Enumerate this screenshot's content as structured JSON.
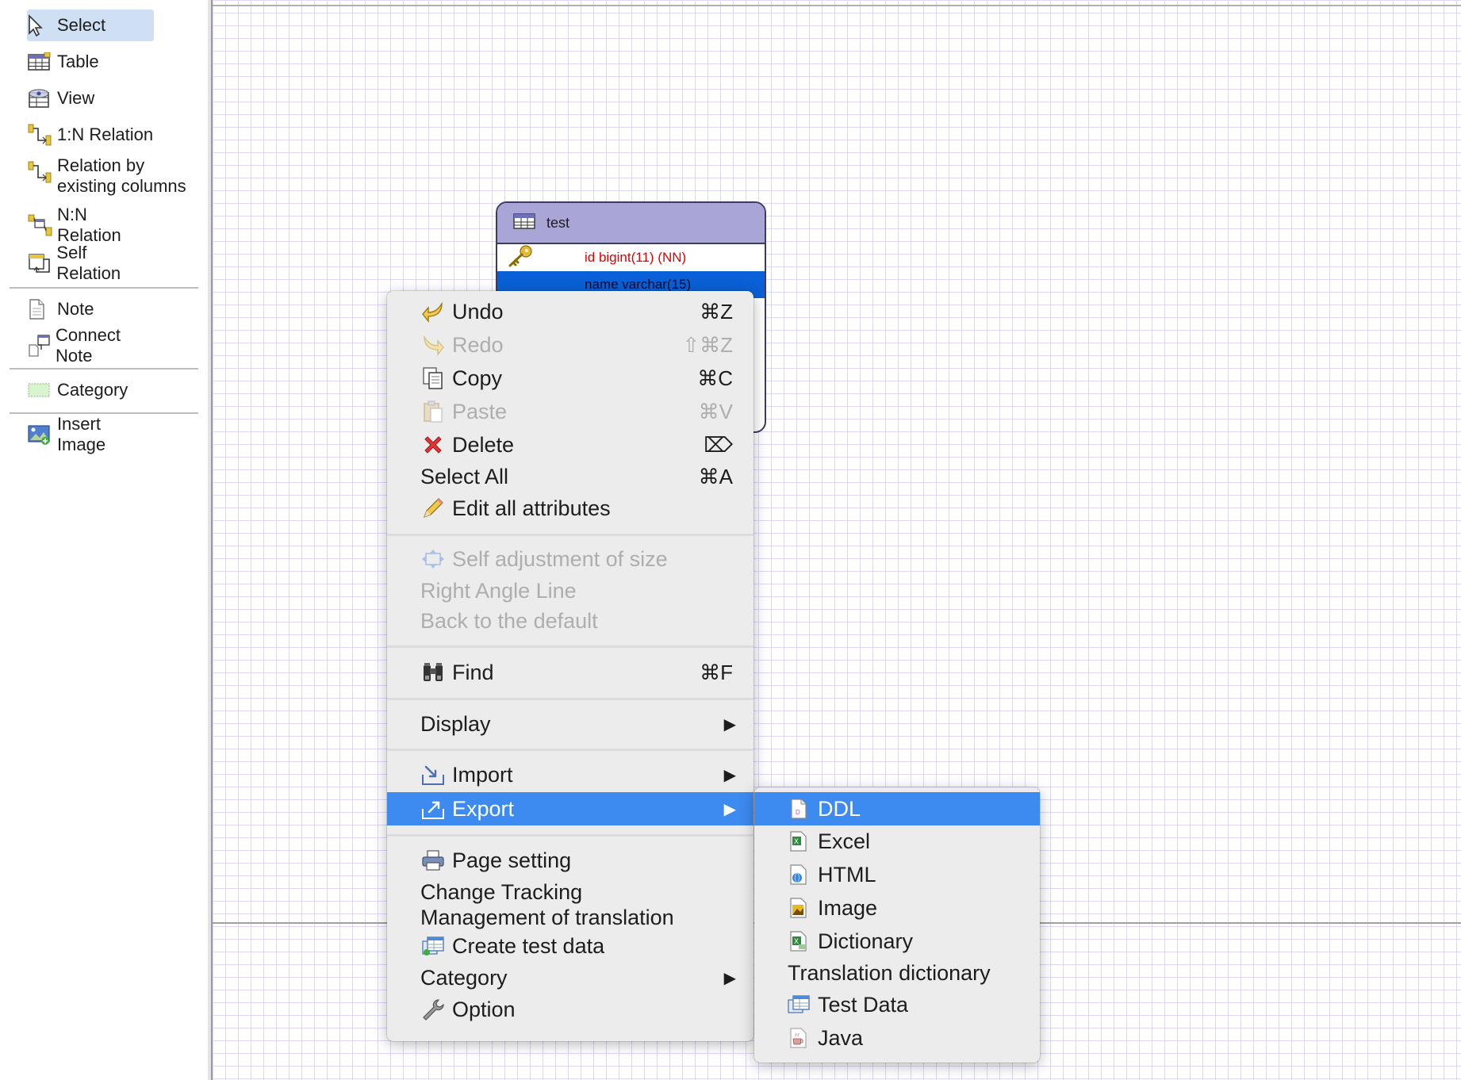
{
  "palette": {
    "items": [
      {
        "label": "Select",
        "icon": "cursor-icon"
      },
      {
        "label": "Table",
        "icon": "table-icon"
      },
      {
        "label": "View",
        "icon": "view-icon"
      },
      {
        "label": "1:N Relation",
        "icon": "relation-1n-icon"
      },
      {
        "label_line1": "Relation by",
        "label_line2": "existing columns",
        "icon": "relation-existing-icon"
      },
      {
        "label": "N:N Relation",
        "icon": "relation-nn-icon"
      },
      {
        "label": "Self Relation",
        "icon": "self-relation-icon"
      },
      {
        "label": "Note",
        "icon": "note-icon"
      },
      {
        "label": "Connect Note",
        "icon": "connect-note-icon"
      },
      {
        "label": "Category",
        "icon": "category-icon"
      },
      {
        "label": "Insert Image",
        "icon": "insert-image-icon"
      }
    ]
  },
  "entity": {
    "name": "test",
    "columns": [
      {
        "text": "id bigint(11) (NN)",
        "primary_key": true
      },
      {
        "text": "name varchar(15)",
        "primary_key": false
      }
    ]
  },
  "context_menu": {
    "undo": {
      "label": "Undo",
      "shortcut": "⌘Z"
    },
    "redo": {
      "label": "Redo",
      "shortcut": "⇧⌘Z"
    },
    "copy": {
      "label": "Copy",
      "shortcut": "⌘C"
    },
    "paste": {
      "label": "Paste",
      "shortcut": "⌘V"
    },
    "delete": {
      "label": "Delete",
      "shortcut": "⌦"
    },
    "select_all": {
      "label": "Select All",
      "shortcut": "⌘A"
    },
    "edit_all": {
      "label": "Edit all attributes"
    },
    "self_adjust": {
      "label": "Self adjustment of size"
    },
    "right_angle": {
      "label": "Right Angle Line"
    },
    "back_default": {
      "label": "Back to the default"
    },
    "find": {
      "label": "Find",
      "shortcut": "⌘F"
    },
    "display": {
      "label": "Display",
      "arrow": "▶"
    },
    "import": {
      "label": "Import",
      "arrow": "▶"
    },
    "export": {
      "label": "Export",
      "arrow": "▶"
    },
    "page_setting": {
      "label": "Page setting"
    },
    "change_tracking": {
      "label": "Change Tracking"
    },
    "translation": {
      "label": "Management of translation"
    },
    "test_data": {
      "label": "Create test data"
    },
    "category": {
      "label": "Category",
      "arrow": "▶"
    },
    "option": {
      "label": "Option"
    }
  },
  "export_submenu": {
    "ddl": {
      "label": "DDL"
    },
    "excel": {
      "label": "Excel"
    },
    "html": {
      "label": "HTML"
    },
    "image": {
      "label": "Image"
    },
    "dictionary": {
      "label": "Dictionary"
    },
    "translation_dictionary": {
      "label": "Translation dictionary"
    },
    "test_data": {
      "label": "Test Data"
    },
    "java": {
      "label": "Java"
    }
  },
  "colors": {
    "highlight": "#3d8af0",
    "entity_header": "#a9a5d6",
    "primary_key": "#e00000",
    "selected_row": "#0a60d6"
  }
}
